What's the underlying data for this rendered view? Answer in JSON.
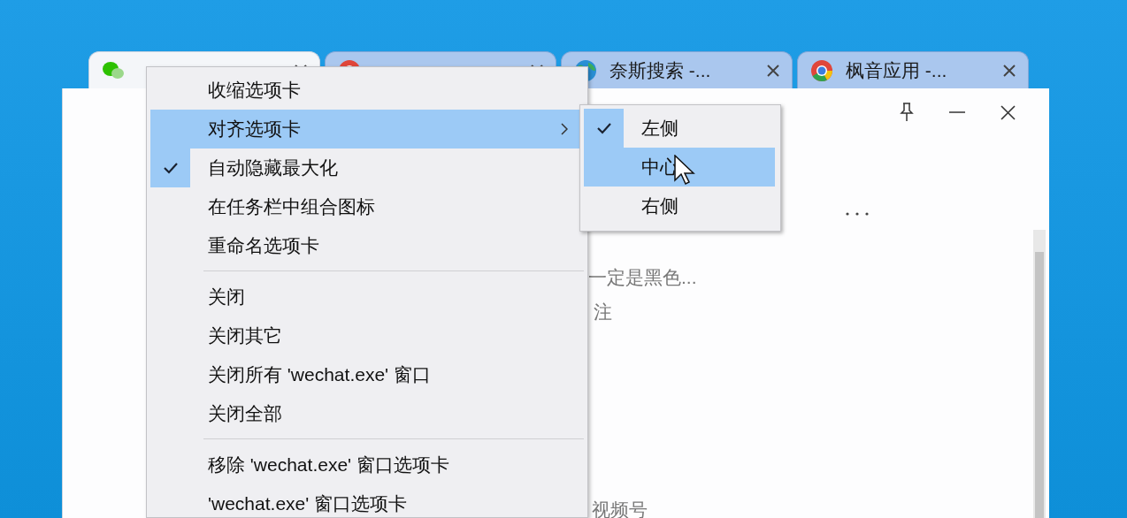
{
  "tabs": [
    {
      "selected": true
    },
    {
      "selected": false
    },
    {
      "label": "奈斯搜索 -...",
      "selected": false
    },
    {
      "label": "枫音应用 -...",
      "selected": false
    }
  ],
  "window": {
    "content": [
      "一定是黑色...",
      "注",
      "视频号"
    ]
  },
  "menu": {
    "items": [
      {
        "kind": "item",
        "label": "收缩选项卡",
        "checked": false,
        "selected": false,
        "has_submenu": false
      },
      {
        "kind": "item",
        "label": "对齐选项卡",
        "checked": false,
        "selected": true,
        "has_submenu": true
      },
      {
        "kind": "item",
        "label": "自动隐藏最大化",
        "checked": true,
        "selected": false,
        "has_submenu": false
      },
      {
        "kind": "item",
        "label": "在任务栏中组合图标",
        "checked": false,
        "selected": false,
        "has_submenu": false
      },
      {
        "kind": "item",
        "label": "重命名选项卡",
        "checked": false,
        "selected": false,
        "has_submenu": false
      },
      {
        "kind": "separator"
      },
      {
        "kind": "item",
        "label": "关闭",
        "checked": false,
        "selected": false,
        "has_submenu": false
      },
      {
        "kind": "item",
        "label": "关闭其它",
        "checked": false,
        "selected": false,
        "has_submenu": false
      },
      {
        "kind": "item",
        "label": "关闭所有 'wechat.exe' 窗口",
        "checked": false,
        "selected": false,
        "has_submenu": false
      },
      {
        "kind": "item",
        "label": "关闭全部",
        "checked": false,
        "selected": false,
        "has_submenu": false
      },
      {
        "kind": "separator"
      },
      {
        "kind": "item",
        "label": "移除 'wechat.exe' 窗口选项卡",
        "checked": false,
        "selected": false,
        "has_submenu": false
      },
      {
        "kind": "item",
        "label": "'wechat.exe' 窗口选项卡",
        "checked": false,
        "selected": false,
        "has_submenu": false
      }
    ]
  },
  "submenu": {
    "items": [
      {
        "label": "左侧",
        "checked": true,
        "selected": false
      },
      {
        "label": "中心",
        "checked": false,
        "selected": true
      },
      {
        "label": "右侧",
        "checked": false,
        "selected": false
      }
    ]
  }
}
